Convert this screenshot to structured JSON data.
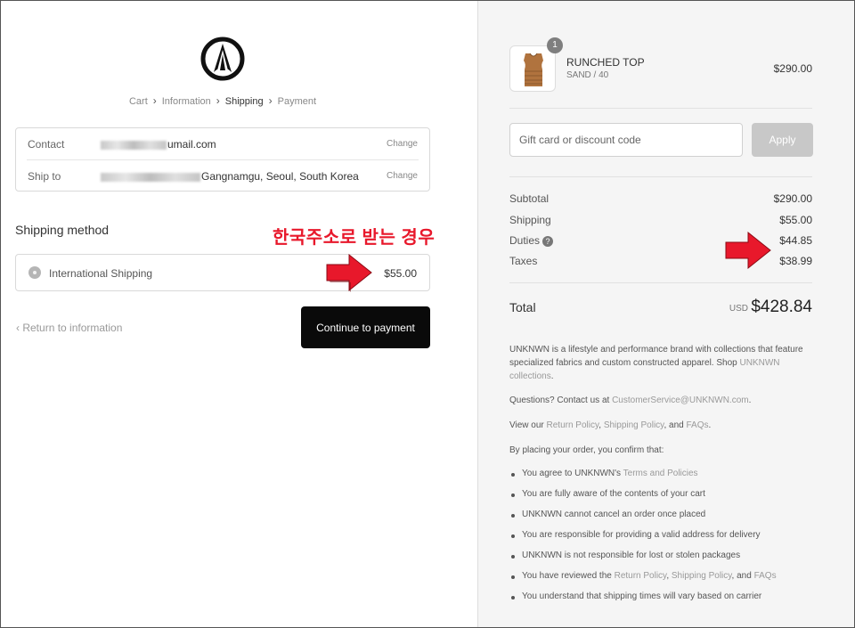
{
  "breadcrumb": {
    "items": [
      "Cart",
      "Information",
      "Shipping",
      "Payment"
    ],
    "active_index": 2
  },
  "contact": {
    "label": "Contact",
    "value_visible": "umail.com",
    "change_label": "Change"
  },
  "ship_to": {
    "label": "Ship to",
    "value_visible": "Gangnamgu, Seoul, South Korea",
    "change_label": "Change"
  },
  "shipping_method": {
    "heading": "Shipping method",
    "annotation": "한국주소로 받는 경우",
    "option_name": "International Shipping",
    "option_price": "$55.00"
  },
  "nav": {
    "return_label": "Return to information",
    "continue_label": "Continue to payment"
  },
  "product": {
    "quantity": "1",
    "name": "RUNCHED TOP",
    "variant": "SAND / 40",
    "price": "$290.00"
  },
  "discount": {
    "placeholder": "Gift card or discount code",
    "apply_label": "Apply"
  },
  "summary": {
    "subtotal_label": "Subtotal",
    "subtotal_value": "$290.00",
    "shipping_label": "Shipping",
    "shipping_value": "$55.00",
    "duties_label": "Duties",
    "duties_value": "$44.85",
    "taxes_label": "Taxes",
    "taxes_value": "$38.99",
    "total_label": "Total",
    "total_currency": "USD",
    "total_value": "$428.84"
  },
  "legal": {
    "about_text": "UNKNWN is a lifestyle and performance brand with collections that feature specialized fabrics and custom constructed apparel. Shop ",
    "about_link": "UNKNWN collections",
    "about_end": ".",
    "questions_text": "Questions? Contact us at ",
    "questions_email": "CustomerService@UNKNWN.com",
    "questions_end": ".",
    "view_text": "View our ",
    "return_policy": "Return Policy",
    "comma": ", ",
    "shipping_policy": "Shipping Policy",
    "and_text": ", and ",
    "faqs": "FAQs",
    "period": ".",
    "confirm_text": "By placing your order, you confirm that:",
    "bullet_1_text": "You agree to UNKNWN's ",
    "bullet_1_link": "Terms and Policies",
    "bullet_2": "You are fully aware of the contents of your cart",
    "bullet_3": "UNKNWN cannot cancel an order once placed",
    "bullet_4": "You are responsible for providing a valid address for delivery",
    "bullet_5": "UNKNWN is not responsible for lost or stolen packages",
    "bullet_6_text": "You have reviewed the ",
    "bullet_6_link1": "Return Policy",
    "bullet_6_comma": ", ",
    "bullet_6_link2": "Shipping Policy",
    "bullet_6_and": ", and ",
    "bullet_6_link3": "FAQs",
    "bullet_7": "You understand that shipping times will vary based on carrier"
  },
  "colors": {
    "accent_red": "#e8182b",
    "button_dark": "#0a0a0a",
    "panel_bg": "#f5f5f5"
  }
}
